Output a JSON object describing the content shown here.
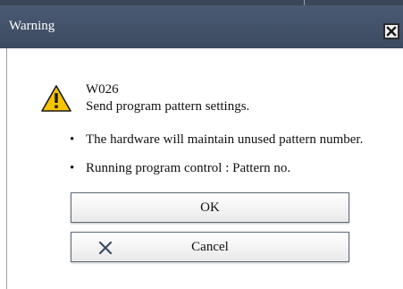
{
  "window": {
    "title": "Warning"
  },
  "message": {
    "code": "W026",
    "text": "Send program pattern settings.",
    "bullets": [
      "The hardware will maintain unused pattern number.",
      "Running program control : Pattern no."
    ]
  },
  "buttons": {
    "ok_label": "OK",
    "cancel_label": "Cancel"
  },
  "icons": {
    "warning": "warning-triangle-icon",
    "close": "close-icon",
    "cancel": "x-icon"
  },
  "colors": {
    "titlebar": "#3b4a60",
    "warning_fill": "#f5c400",
    "cancel_icon": "#3c4b64"
  }
}
